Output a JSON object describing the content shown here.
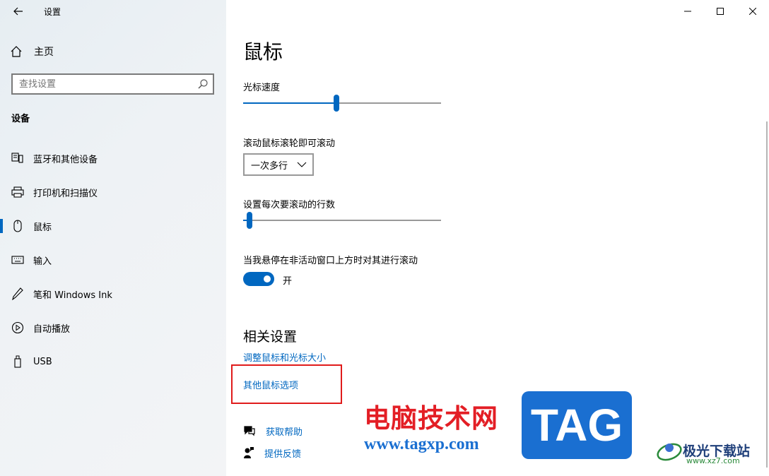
{
  "sidebar": {
    "app_title": "设置",
    "home_label": "主页",
    "search_placeholder": "查找设置",
    "section_title": "设备",
    "items": [
      {
        "label": "蓝牙和其他设备",
        "icon": "bluetooth-devices-icon"
      },
      {
        "label": "打印机和扫描仪",
        "icon": "printer-icon"
      },
      {
        "label": "鼠标",
        "icon": "mouse-icon",
        "selected": true
      },
      {
        "label": "输入",
        "icon": "keyboard-icon"
      },
      {
        "label": "笔和 Windows Ink",
        "icon": "pen-icon"
      },
      {
        "label": "自动播放",
        "icon": "autoplay-icon"
      },
      {
        "label": "USB",
        "icon": "usb-icon"
      }
    ]
  },
  "main": {
    "title": "鼠标",
    "cursor_speed": {
      "label": "光标速度",
      "value_fraction": 0.47
    },
    "scroll_wheel": {
      "label": "滚动鼠标滚轮即可滚动",
      "selected": "一次多行"
    },
    "scroll_lines": {
      "label": "设置每次要滚动的行数",
      "value_fraction": 0.02
    },
    "inactive_scroll": {
      "label": "当我悬停在非活动窗口上方时对其进行滚动",
      "state_label": "开",
      "on": true
    },
    "related": {
      "title": "相关设置",
      "link1": "调整鼠标和光标大小",
      "link2": "其他鼠标选项"
    },
    "help": {
      "get_help": "获取帮助",
      "feedback": "提供反馈"
    }
  },
  "watermark": {
    "site_cn": "电脑技术网",
    "site_url": "www.tagxp.com",
    "tag": "TAG",
    "corner_cn": "极光下载站",
    "corner_url": "www.xz7.com"
  },
  "colors": {
    "accent": "#0067c0",
    "highlight": "#e01b1b"
  }
}
